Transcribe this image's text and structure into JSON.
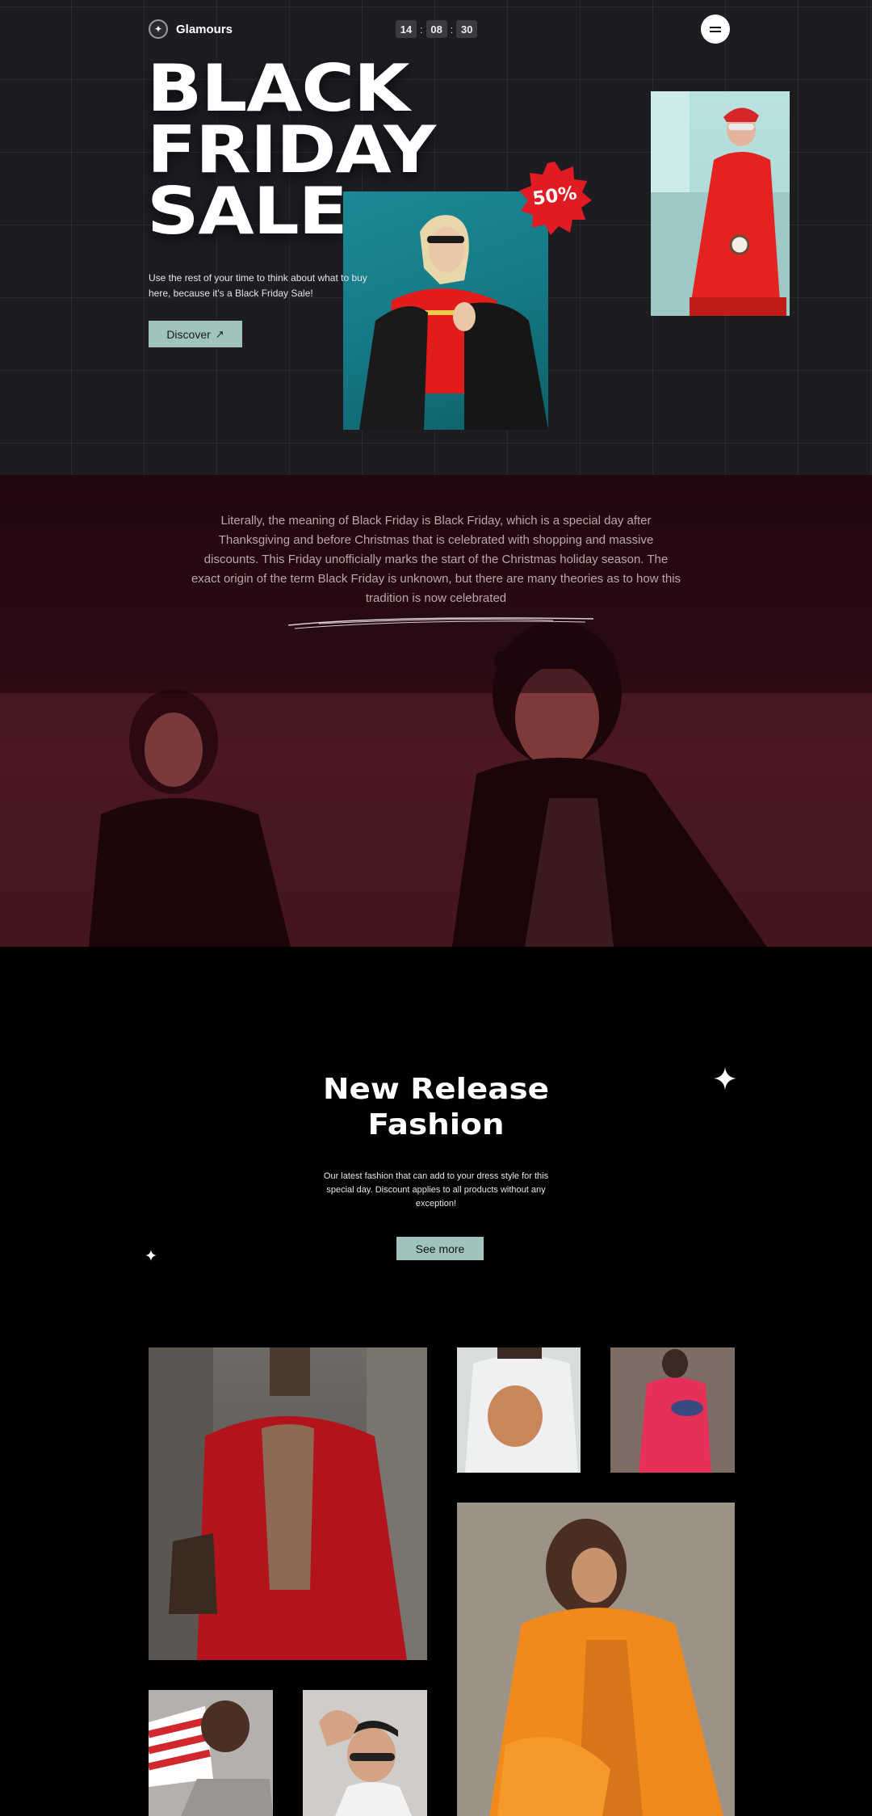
{
  "header": {
    "brand": "Glamours",
    "countdown": {
      "hours": "14",
      "minutes": "08",
      "seconds": "30",
      "separator": ":"
    }
  },
  "hero": {
    "title_lines": [
      "BLACK",
      "FRIDAY",
      "SALE"
    ],
    "description": "Use the rest of your time to think about what to buy here, because it's a Black Friday Sale!",
    "discover_label": "Discover",
    "discount_badge": "50%"
  },
  "about": {
    "text": "Literally, the meaning of Black Friday is Black Friday, which is a special day after Thanksgiving and before Christmas that is celebrated with shopping and massive discounts. This Friday unofficially marks the start of the Christmas holiday season. The exact origin of the term Black Friday is unknown, but there are many theories as to how this tradition is now celebrated"
  },
  "release": {
    "title": "New Release Fashion",
    "description": "Our latest fashion that can add to your dress style for this special day. Discount applies to all products without any exception!",
    "see_more_label": "See more"
  },
  "colors": {
    "hero_bg": "#1d1c21",
    "accent_button": "#9fc4bd",
    "badge_red": "#e01b24",
    "about_tint": "#3b1016",
    "page_bg": "#000000"
  }
}
